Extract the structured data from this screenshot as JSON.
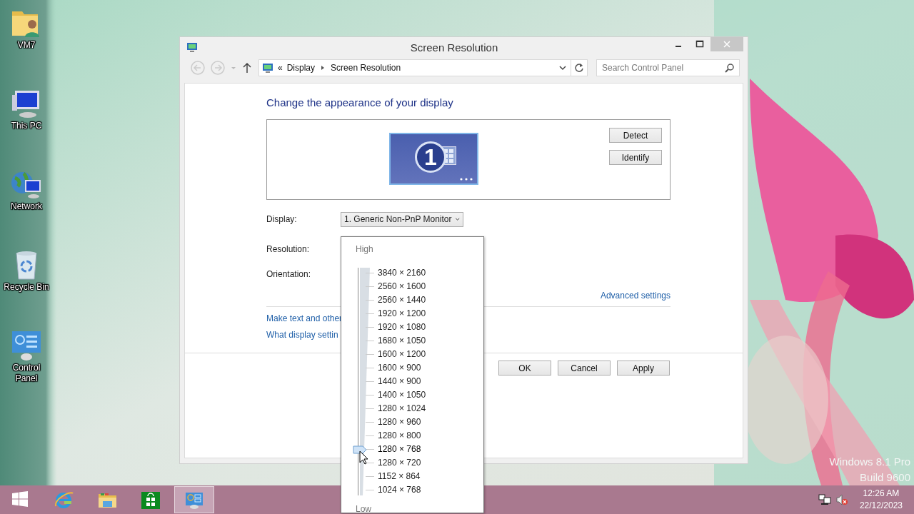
{
  "desktop_icons": [
    {
      "label": "VM7",
      "kind": "user-folder"
    },
    {
      "label": "This PC",
      "kind": "computer"
    },
    {
      "label": "Network",
      "kind": "network"
    },
    {
      "label": "Recycle Bin",
      "kind": "recycle"
    },
    {
      "label": "Control Panel",
      "kind": "control-panel"
    }
  ],
  "window": {
    "title": "Screen Resolution"
  },
  "address": {
    "crumbs": [
      "Display",
      "Screen Resolution"
    ],
    "overflow": "«"
  },
  "search": {
    "placeholder": "Search Control Panel"
  },
  "heading": "Change the appearance of your display",
  "monitor": {
    "number": "1"
  },
  "side_buttons": [
    "Detect",
    "Identify"
  ],
  "fields": [
    {
      "label": "Display:",
      "value": "1. Generic Non-PnP Monitor"
    },
    {
      "label": "Resolution:"
    },
    {
      "label": "Orientation:"
    }
  ],
  "advanced_link": "Advanced settings",
  "links": [
    "Make text and other",
    "What display settin"
  ],
  "buttons": [
    "OK",
    "Cancel",
    "Apply"
  ],
  "resolution": {
    "high_label": "High",
    "low_label": "Low",
    "options": [
      {
        "label": "3840 × 2160",
        "selected": false
      },
      {
        "label": "2560 × 1600",
        "selected": false
      },
      {
        "label": "2560 × 1440",
        "selected": false
      },
      {
        "label": "1920 × 1200",
        "selected": false
      },
      {
        "label": "1920 × 1080",
        "selected": false
      },
      {
        "label": "1680 × 1050",
        "selected": false
      },
      {
        "label": "1600 × 1200",
        "selected": false
      },
      {
        "label": "1600 × 900",
        "selected": false
      },
      {
        "label": "1440 × 900",
        "selected": false
      },
      {
        "label": "1400 × 1050",
        "selected": false
      },
      {
        "label": "1280 × 1024",
        "selected": false
      },
      {
        "label": "1280 × 960",
        "selected": false
      },
      {
        "label": "1280 × 800",
        "selected": false
      },
      {
        "label": "1280 × 768",
        "selected": true
      },
      {
        "label": "1280 × 720",
        "selected": false
      },
      {
        "label": "1152 × 864",
        "selected": false
      },
      {
        "label": "1024 × 768",
        "selected": false
      }
    ]
  },
  "watermark": [
    "Windows 8.1 Pro",
    "Build 9600"
  ],
  "taskbar": {
    "items": [
      {
        "kind": "start",
        "selected": false
      },
      {
        "kind": "browser",
        "selected": false
      },
      {
        "kind": "explorer",
        "selected": false
      },
      {
        "kind": "store",
        "selected": false
      },
      {
        "kind": "control-panel",
        "selected": true
      }
    ],
    "clock": {
      "time": "12:26 AM",
      "date": "22/12/2023"
    }
  }
}
